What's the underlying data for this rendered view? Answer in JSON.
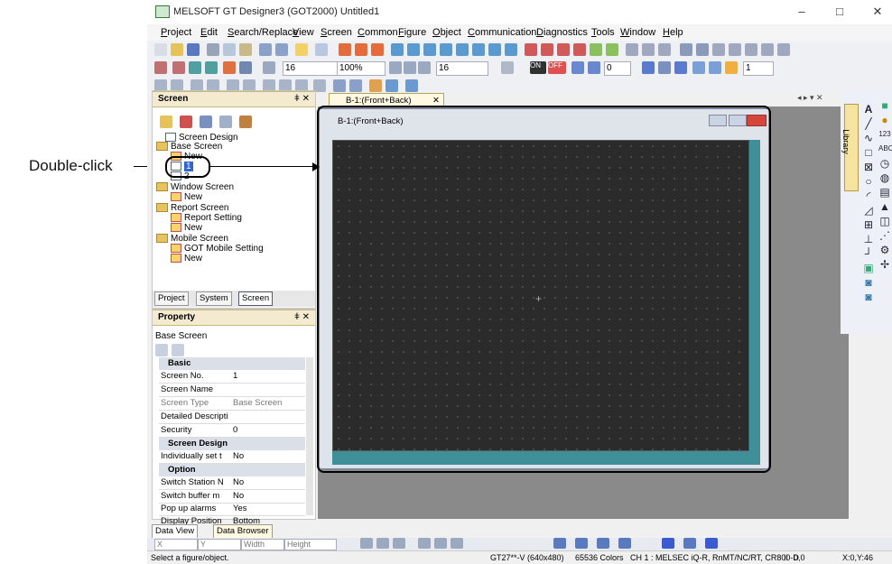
{
  "annotation": {
    "label": "Double-click"
  },
  "window": {
    "title": "MELSOFT GT Designer3 (GOT2000) Untitled1",
    "controls": [
      "–",
      "□",
      "✕"
    ]
  },
  "menu": [
    "Project",
    "Edit",
    "Search/Replace",
    "View",
    "Screen",
    "Common",
    "Figure",
    "Object",
    "Communication",
    "Diagnostics",
    "Tools",
    "Window",
    "Help"
  ],
  "toolbar": {
    "font_size_1": "16",
    "zoom": "100%",
    "font_size_2": "16",
    "spin_value": "0",
    "page_value": "1",
    "on_label": "ON",
    "off_label": "OFF"
  },
  "screen_panel": {
    "title": "Screen",
    "tree": {
      "screen_design": "Screen Design",
      "base_screen": "Base Screen",
      "new_1": "New",
      "item_1": "1",
      "item_2": "2",
      "window_screen": "Window Screen",
      "new_2": "New",
      "report_screen": "Report Screen",
      "report_setting": "Report Setting",
      "new_3": "New",
      "mobile_screen": "Mobile Screen",
      "got_mobile_setting": "GOT Mobile Setting",
      "new_4": "New"
    },
    "tabs": [
      "Project",
      "System",
      "Screen"
    ]
  },
  "property_panel": {
    "title": "Property",
    "subject": "Base Screen",
    "categories": {
      "basic": "Basic",
      "screen_design": "Screen Design",
      "option": "Option"
    },
    "rows": [
      {
        "key": "Screen No.",
        "value": "1"
      },
      {
        "key": "Screen Name",
        "value": ""
      },
      {
        "key": "Screen Type",
        "value": "Base Screen"
      },
      {
        "key": "Detailed Descriptio",
        "value": ""
      },
      {
        "key": "Security",
        "value": "0"
      },
      {
        "key": "Individually set t",
        "value": "No"
      },
      {
        "key": "Switch Station N",
        "value": "No"
      },
      {
        "key": "Switch buffer m",
        "value": "No"
      },
      {
        "key": "Pop up alarms",
        "value": "Yes"
      },
      {
        "key": "Display Position",
        "value": "Bottom"
      }
    ]
  },
  "editor": {
    "tab_label": "B-1:(Front+Back)",
    "window_title": "B-1:(Front+Back)"
  },
  "right_panel": {
    "library_label": "Library"
  },
  "bottom": {
    "tabs": [
      "Data View",
      "Data Browser"
    ],
    "coord_fields": {
      "x": "X",
      "y": "Y",
      "width": "Width",
      "height": "Height"
    }
  },
  "status": {
    "left": "Select a figure/object.",
    "got": "GT27**-V (640x480)",
    "colors": "65536 Colors",
    "channel": "CH 1 : MELSEC iQ-R, RnMT/NC/RT, CR800-D",
    "snap": "0,0",
    "coords": "X:0,Y:46"
  }
}
